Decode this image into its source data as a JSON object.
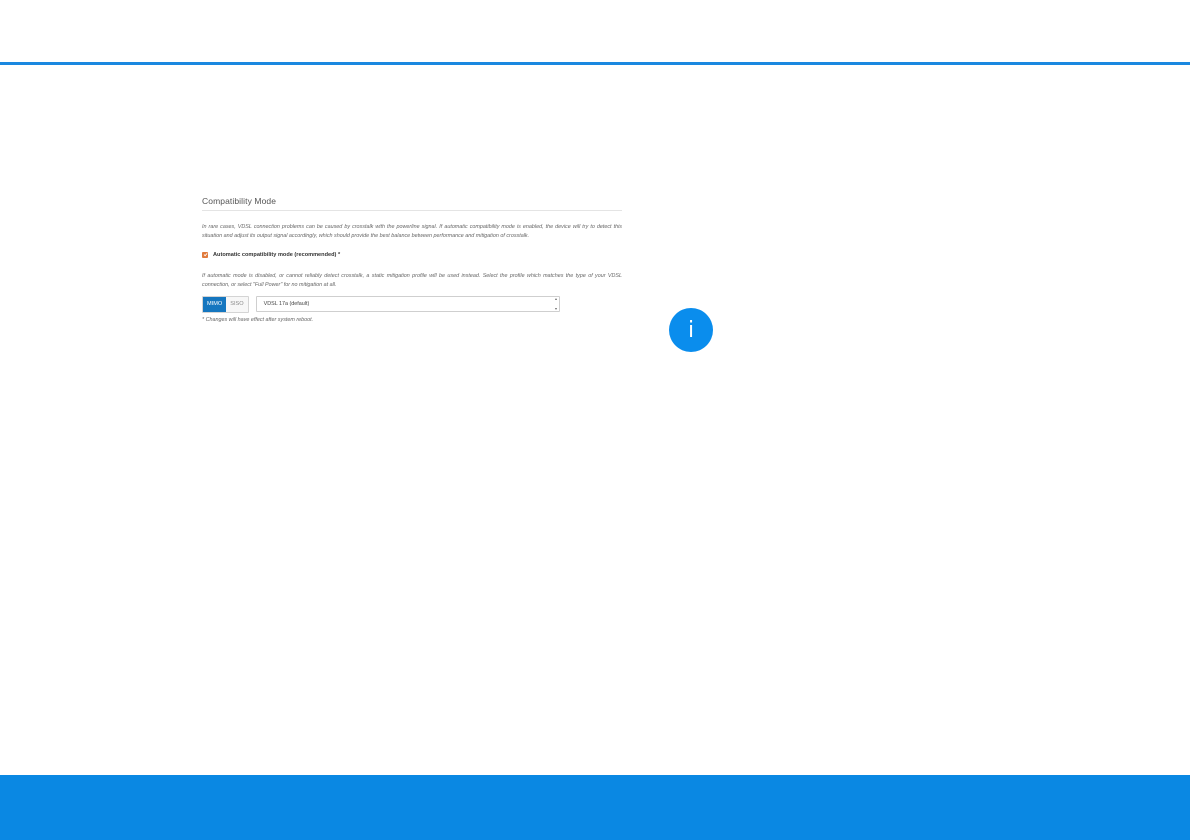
{
  "section": {
    "title": "Compatibility Mode",
    "description": "In rare cases, VDSL connection problems can be caused by crosstalk with the powerline signal. If automatic compatibility mode is enabled, the device will try to detect this situation and adjust its output signal accordingly, which should provide the best balance between performance and mitigation of crosstalk.",
    "checkbox": {
      "label": "Automatic compatibility mode (recommended) *",
      "checked": true
    },
    "profile_description": "If automatic mode is disabled, or cannot reliably detect crosstalk, a static mitigation profile will be used instead. Select the profile which matches the type of your VDSL connection, or select \"Full Power\" for no mitigation at all.",
    "mode_buttons": [
      "MIMO",
      "SISO"
    ],
    "mode_selected": "MIMO",
    "profile_select": {
      "value": "VDSL 17a (default)"
    },
    "note": "* Changes will have effect after system reboot."
  },
  "info_icon": {
    "glyph": "i"
  },
  "colors": {
    "accent": "#1a88e0",
    "footer": "#0a88e3",
    "checkbox": "#e07a3c",
    "active_button": "#1576bf"
  }
}
